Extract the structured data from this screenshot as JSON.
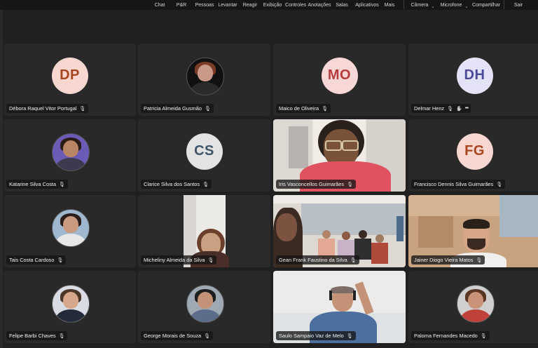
{
  "toolbar": {
    "items": [
      {
        "label": "Chat",
        "icon": "chat-icon"
      },
      {
        "label": "P&R",
        "icon": "qa-icon"
      },
      {
        "label": "Pessoas",
        "icon": "people-icon"
      },
      {
        "label": "Levantar",
        "icon": "raise-hand-icon"
      },
      {
        "label": "Reagir",
        "icon": "react-icon"
      },
      {
        "label": "Exibição",
        "icon": "view-icon"
      },
      {
        "label": "Controles",
        "icon": "controls-icon"
      },
      {
        "label": "Anotações",
        "icon": "annotations-icon"
      },
      {
        "label": "Salas",
        "icon": "rooms-icon"
      },
      {
        "label": "Aplicativos",
        "icon": "apps-icon"
      },
      {
        "label": "Mais",
        "icon": "more-icon"
      }
    ],
    "camera": "Câmera",
    "microphone": "Microfone",
    "share": "Compartilhar",
    "leave": "Sair"
  },
  "participants": [
    {
      "name": "Débora Raquel Vitor Portugal",
      "initials": "DP",
      "type": "initials",
      "bg": "#f7d7cf",
      "fg": "#a8451f"
    },
    {
      "name": "Patricia Almeida Gusmão",
      "type": "avatar",
      "skin": "#c9998a",
      "hair": "#7a3b27",
      "shirt": "#2b2b2b",
      "ring": "#111111"
    },
    {
      "name": "Maico de Oliveira",
      "initials": "MO",
      "type": "initials",
      "bg": "#f8d8d6",
      "fg": "#b53d3d"
    },
    {
      "name": "Delmar Henz",
      "initials": "DH",
      "type": "initials",
      "bg": "#e4e2f7",
      "fg": "#4b4a9a",
      "extras": true
    },
    {
      "name": "Katarine Silva Costa",
      "type": "avatar",
      "skin": "#b88565",
      "hair": "#2a1c17",
      "shirt": "#3b3a4f",
      "ring": "#6b5bb7"
    },
    {
      "name": "Clarice Silva dos Santos",
      "initials": "CS",
      "type": "initials",
      "bg": "#e3e3e3",
      "fg": "#3e5569"
    },
    {
      "name": "Iris Vasconcellos Guimarães",
      "type": "video",
      "scene": "iris"
    },
    {
      "name": "Francisco Dennis Silva Guimarães",
      "initials": "FG",
      "type": "initials",
      "bg": "#f7d7cf",
      "fg": "#a8451f"
    },
    {
      "name": "Tais Costa Cardoso",
      "type": "avatar",
      "skin": "#c99a7e",
      "hair": "#2b1e1a",
      "shirt": "#e7e7e7",
      "ring": "#9fb8d0"
    },
    {
      "name": "Micheliny Almeida da Silva",
      "type": "video",
      "scene": "micheliny"
    },
    {
      "name": "Gean Frank Faustino da Silva",
      "type": "video",
      "scene": "gean"
    },
    {
      "name": "Jainer Diogo Vieira Matos",
      "type": "video",
      "scene": "jainer"
    },
    {
      "name": "Felipe Barbi Chaves",
      "type": "avatar",
      "skin": "#d6a78b",
      "hair": "#4a3529",
      "shirt": "#232a3a",
      "ring": "#d9dde3"
    },
    {
      "name": "George Morais de Souza",
      "type": "avatar",
      "skin": "#c49276",
      "hair": "#1e1e1e",
      "shirt": "#5b6d8a",
      "ring": "#9fa9b4"
    },
    {
      "name": "Saulo Sampaio Vaz de Melo",
      "type": "video",
      "scene": "saulo"
    },
    {
      "name": "Paloma Fernandes Macedo",
      "type": "avatar",
      "skin": "#c89378",
      "hair": "#5a3524",
      "shirt": "#c0413a",
      "ring": "#cfcfcf"
    }
  ]
}
